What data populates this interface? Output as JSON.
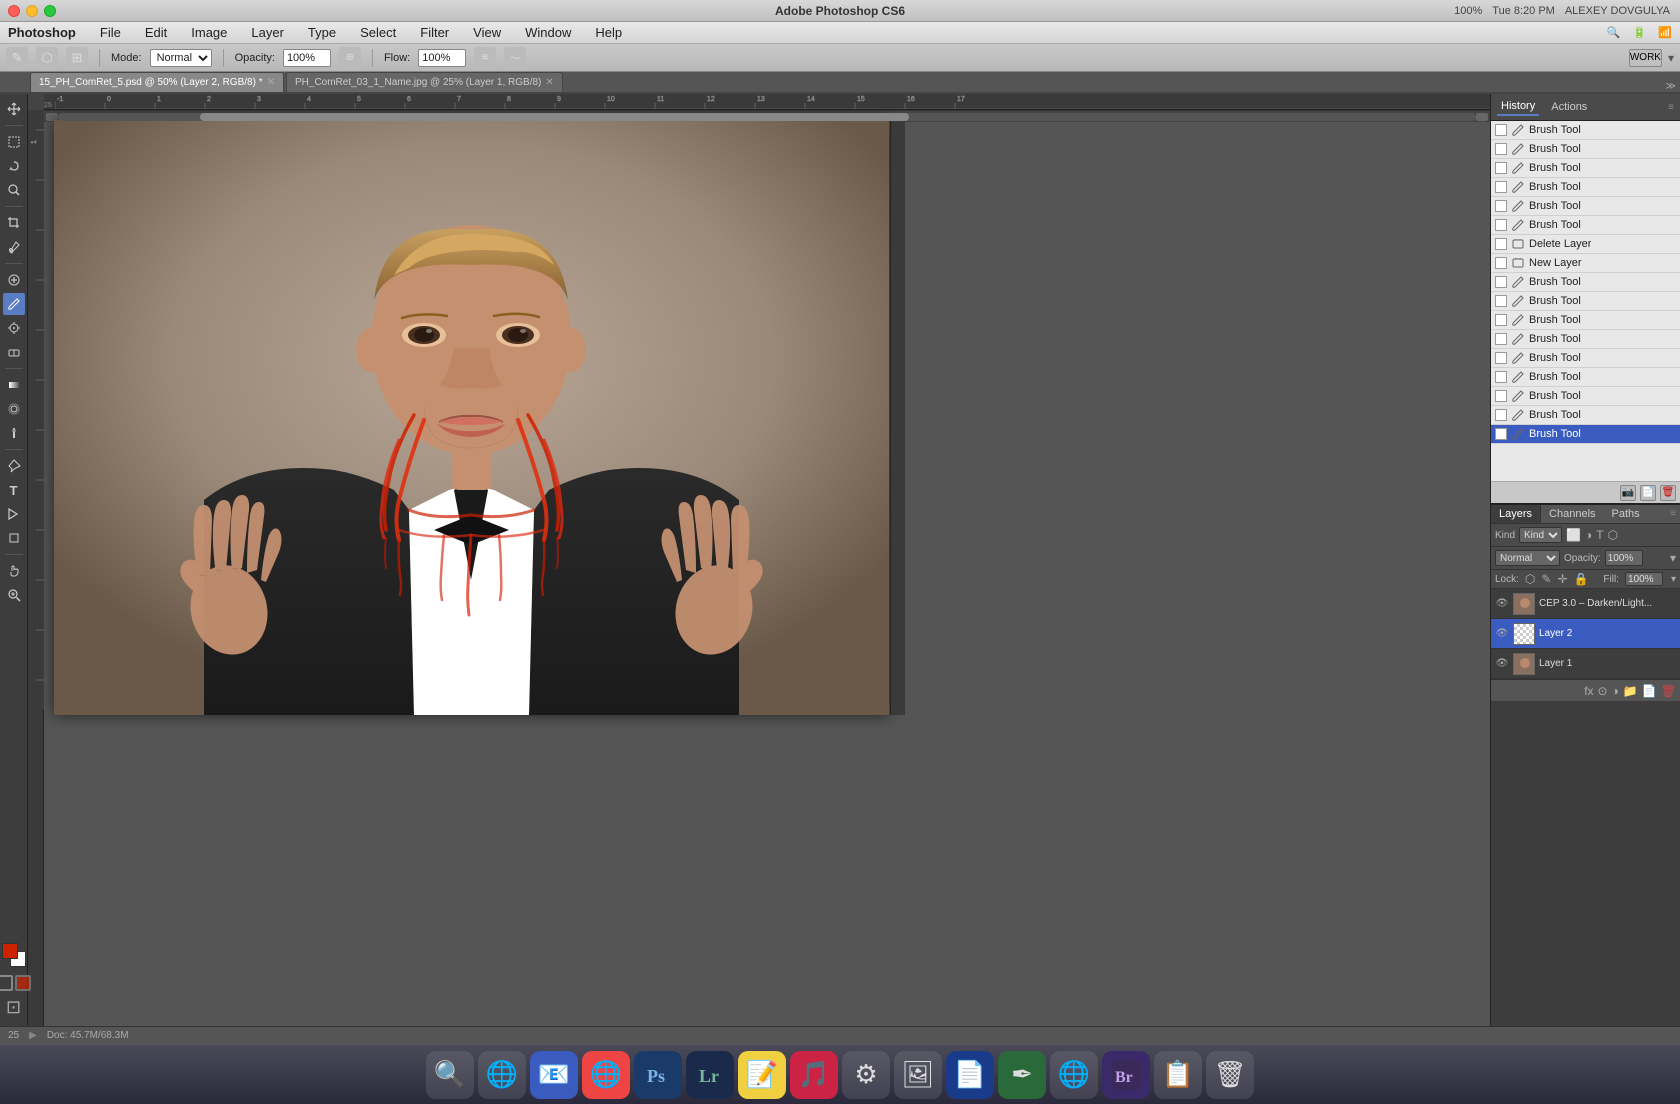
{
  "titlebar": {
    "title": "Adobe Photoshop CS6",
    "time": "Tue 8:20 PM",
    "user": "ALEXEY DOVGULYA",
    "zoom_label": "100%"
  },
  "menubar": {
    "app_name": "Photoshop",
    "menus": [
      "File",
      "Edit",
      "Image",
      "Layer",
      "Type",
      "Select",
      "Filter",
      "View",
      "Window",
      "Help"
    ]
  },
  "optionsbar": {
    "mode_label": "Mode:",
    "mode_value": "Normal",
    "opacity_label": "Opacity:",
    "opacity_value": "100%",
    "flow_label": "Flow:",
    "flow_value": "100%"
  },
  "tabs": [
    {
      "label": "15_PH_ComRet_5.psd @ 50% (Layer 2, RGB/8)",
      "active": true,
      "modified": true
    },
    {
      "label": "PH_ComRet_03_1_Name.jpg @ 25% (Layer 1, RGB/8)",
      "active": false,
      "modified": false
    }
  ],
  "workspace": {
    "name": "WORK"
  },
  "history": {
    "panel_tabs": [
      "History",
      "Actions"
    ],
    "items": [
      {
        "label": "Brush Tool",
        "icon": "brush",
        "active": false
      },
      {
        "label": "Brush Tool",
        "icon": "brush",
        "active": false
      },
      {
        "label": "Brush Tool",
        "icon": "brush",
        "active": false
      },
      {
        "label": "Brush Tool",
        "icon": "brush",
        "active": false
      },
      {
        "label": "Brush Tool",
        "icon": "brush",
        "active": false
      },
      {
        "label": "Brush Tool",
        "icon": "brush",
        "active": false
      },
      {
        "label": "Delete Layer",
        "icon": "layer",
        "active": false
      },
      {
        "label": "New Layer",
        "icon": "layer",
        "active": false
      },
      {
        "label": "Brush Tool",
        "icon": "brush",
        "active": false
      },
      {
        "label": "Brush Tool",
        "icon": "brush",
        "active": false
      },
      {
        "label": "Brush Tool",
        "icon": "brush",
        "active": false
      },
      {
        "label": "Brush Tool",
        "icon": "brush",
        "active": false
      },
      {
        "label": "Brush Tool",
        "icon": "brush",
        "active": false
      },
      {
        "label": "Brush Tool",
        "icon": "brush",
        "active": false
      },
      {
        "label": "Brush Tool",
        "icon": "brush",
        "active": false
      },
      {
        "label": "Brush Tool",
        "icon": "brush",
        "active": false
      },
      {
        "label": "Brush Tool",
        "icon": "brush",
        "active": true
      }
    ]
  },
  "layers": {
    "tabs": [
      "Layers",
      "Channels",
      "Paths"
    ],
    "filter_label": "Kind",
    "blend_mode": "Normal",
    "opacity_label": "Opacity:",
    "opacity_value": "100%",
    "fill_label": "Fill:",
    "fill_value": "100%",
    "lock_label": "Lock:",
    "items": [
      {
        "name": "CEP 3.0 – Darken/Light...",
        "visible": true,
        "active": false,
        "thumb_color": "#8a7060"
      },
      {
        "name": "Layer 2",
        "visible": true,
        "active": true,
        "thumb_color": "#d0d0d0"
      },
      {
        "name": "Layer 1",
        "visible": true,
        "active": false,
        "thumb_color": "#8a7060"
      }
    ]
  },
  "statusbar": {
    "brush_size": "25",
    "doc_info": "Doc: 45.7M/68.3M"
  },
  "dock": {
    "icons": [
      "🔍",
      "🌐",
      "📧",
      "🌐",
      "🎨",
      "🖼",
      "📝",
      "🎵",
      "⚙",
      "🖼",
      "📄",
      "🖊",
      "🌐",
      "🖥",
      "📋",
      "🗑"
    ]
  },
  "tools": {
    "active": "brush",
    "items": [
      {
        "name": "move",
        "symbol": "✛"
      },
      {
        "name": "marquee",
        "symbol": "⬜"
      },
      {
        "name": "lasso",
        "symbol": "⬡"
      },
      {
        "name": "quick-select",
        "symbol": "✺"
      },
      {
        "name": "crop",
        "symbol": "⊞"
      },
      {
        "name": "eyedropper",
        "symbol": "✏"
      },
      {
        "name": "healing",
        "symbol": "⊕"
      },
      {
        "name": "brush",
        "symbol": "✎"
      },
      {
        "name": "clone",
        "symbol": "⊜"
      },
      {
        "name": "eraser",
        "symbol": "◻"
      },
      {
        "name": "gradient",
        "symbol": "▦"
      },
      {
        "name": "blur",
        "symbol": "◕"
      },
      {
        "name": "dodge",
        "symbol": "◔"
      },
      {
        "name": "pen",
        "symbol": "✒"
      },
      {
        "name": "text",
        "symbol": "T"
      },
      {
        "name": "path-select",
        "symbol": "↖"
      },
      {
        "name": "shape",
        "symbol": "⬡"
      },
      {
        "name": "hand",
        "symbol": "✋"
      },
      {
        "name": "zoom",
        "symbol": "⊕"
      }
    ]
  }
}
